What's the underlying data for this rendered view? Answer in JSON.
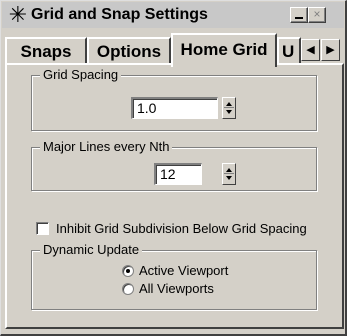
{
  "window": {
    "title": "Grid and Snap Settings",
    "icons": {
      "app": "snowflake-icon",
      "minimize": "minimize-icon",
      "close": "close-icon"
    },
    "close_glyph": "×"
  },
  "tabs": [
    {
      "label": "Snaps",
      "selected": false
    },
    {
      "label": "Options",
      "selected": false
    },
    {
      "label": "Home Grid",
      "selected": true
    },
    {
      "label": "U",
      "selected": false
    }
  ],
  "tab_scroll": {
    "left": "◀",
    "right": "▶"
  },
  "grid_spacing": {
    "label": "Grid Spacing",
    "value": "1.0"
  },
  "major_lines": {
    "label": "Major Lines every Nth",
    "value": "12"
  },
  "inhibit_subdivision": {
    "label": "Inhibit Grid Subdivision Below Grid Spacing",
    "checked": false
  },
  "dynamic_update": {
    "label": "Dynamic Update",
    "options": [
      {
        "label": "Active Viewport",
        "selected": true
      },
      {
        "label": "All Viewports",
        "selected": false
      }
    ]
  },
  "colors": {
    "face": "#d4d0c8",
    "highlight": "#ffffff",
    "shadow": "#808080",
    "dark_shadow": "#404040"
  }
}
